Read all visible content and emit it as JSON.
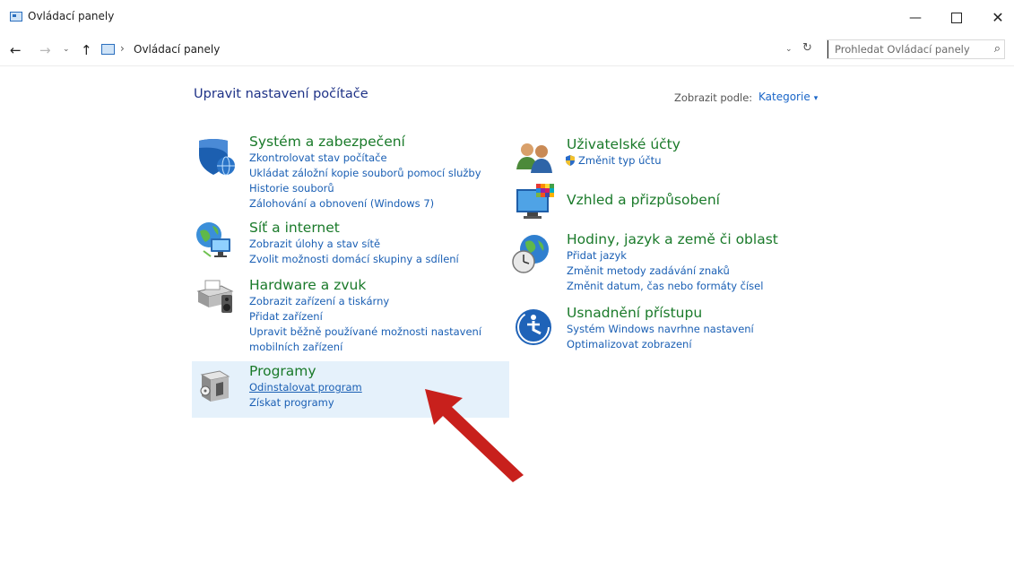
{
  "window": {
    "title": "Ovládací panely",
    "min_glyph": "—",
    "close_glyph": "✕"
  },
  "address": {
    "crumb": "Ovládací panely",
    "crumb_sep": "›",
    "back_glyph": "←",
    "forward_glyph": "→",
    "recent_glyph": "⌄",
    "up_glyph": "↑",
    "dropdown_glyph": "⌄",
    "refresh_glyph": "↻",
    "search_placeholder": "Prohledat Ovládací panely",
    "search_glyph": "⌕"
  },
  "main": {
    "heading": "Upravit nastavení počítače",
    "view_by_label": "Zobrazit podle:",
    "view_by_value": "Kategorie",
    "view_by_caret": "▾"
  },
  "categories_left": [
    {
      "title": "Systém a zabezpečení",
      "icon": "shield-icon",
      "links": [
        "Zkontrolovat stav počítače",
        "Ukládat záložní kopie souborů pomocí služby",
        "Historie souborů",
        "Zálohování a obnovení (Windows 7)"
      ]
    },
    {
      "title": "Síť a internet",
      "icon": "network-globe-icon",
      "links": [
        "Zobrazit úlohy a stav sítě",
        "Zvolit možnosti domácí skupiny a sdílení"
      ]
    },
    {
      "title": "Hardware a zvuk",
      "icon": "printer-speaker-icon",
      "links": [
        "Zobrazit zařízení a tiskárny",
        "Přidat zařízení",
        "Upravit běžně používané možnosti nastavení",
        "mobilních zařízení"
      ]
    },
    {
      "title": "Programy",
      "icon": "programs-box-icon",
      "links": [
        "Odinstalovat program",
        "Získat programy"
      ]
    }
  ],
  "categories_right": [
    {
      "title": "Uživatelské účty",
      "icon": "users-icon",
      "links": [
        "Změnit typ účtu"
      ]
    },
    {
      "title": "Vzhled a přizpůsobení",
      "icon": "monitor-palette-icon",
      "links": []
    },
    {
      "title": "Hodiny, jazyk a země či oblast",
      "icon": "clock-globe-icon",
      "links": [
        "Přidat jazyk",
        "Změnit metody zadávání znaků",
        "Změnit datum, čas nebo formáty čísel"
      ]
    },
    {
      "title": "Usnadnění přístupu",
      "icon": "accessibility-icon",
      "links": [
        "Systém Windows navrhne nastavení",
        "Optimalizovat zobrazení"
      ]
    }
  ],
  "colors": {
    "category_title": "#1a7a2a",
    "link": "#1a5fb4",
    "heading": "#1e3287",
    "highlight": "#e5f1fb",
    "arrow": "#c8201c"
  }
}
